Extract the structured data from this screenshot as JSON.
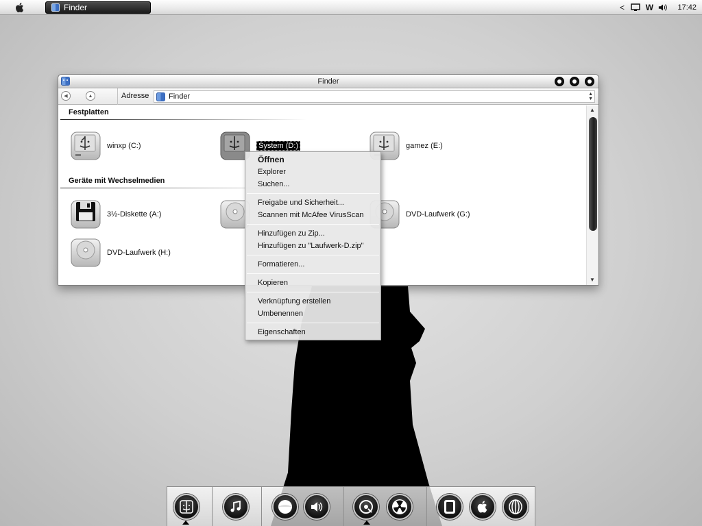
{
  "menubar": {
    "taskbar_item": "Finder",
    "tray": {
      "back_arrow": "<",
      "wordmark": "W",
      "clock": "17:42"
    }
  },
  "window": {
    "title": "Finder",
    "address_label": "Adresse",
    "address_value": "Finder",
    "sections": [
      {
        "title": "Festplatten",
        "drives": [
          {
            "label": "winxp (C:)",
            "icon": "hard-drive-icon"
          },
          {
            "label": "System (D:)",
            "icon": "hard-drive-icon",
            "selected": true
          },
          {
            "label": "gamez (E:)",
            "icon": "hard-drive-icon"
          }
        ]
      },
      {
        "title": "Geräte mit Wechselmedien",
        "drives": [
          {
            "label": "3½-Diskette (A:)",
            "icon": "floppy-drive-icon"
          },
          {
            "label": "",
            "icon": "optical-drive-icon"
          },
          {
            "label": "DVD-Laufwerk (G:)",
            "icon": "optical-drive-icon"
          },
          {
            "label": "DVD-Laufwerk (H:)",
            "icon": "optical-drive-icon"
          }
        ]
      }
    ]
  },
  "context_menu": {
    "groups": [
      [
        "Öffnen",
        "Explorer",
        "Suchen..."
      ],
      [
        "Freigabe und Sicherheit...",
        "Scannen mit McAfee VirusScan"
      ],
      [
        "Hinzufügen zu Zip...",
        "Hinzufügen zu \"Laufwerk-D.zip\""
      ],
      [
        "Formatieren..."
      ],
      [
        "Kopieren"
      ],
      [
        "Verknüpfung erstellen",
        "Umbenennen"
      ],
      [
        "Eigenschaften"
      ]
    ],
    "default_item": "Öffnen"
  },
  "dock": {
    "items": [
      "finder-icon",
      "itunes-icon",
      "media-player-icon",
      "volume-icon",
      "disc-burner-icon",
      "radiation-icon",
      "notes-icon",
      "apple-icon",
      "orb-icon"
    ],
    "running": [
      "finder-icon",
      "disc-burner-icon"
    ]
  },
  "colors": {
    "menubar": "#e9e9e9",
    "selection": "#000000",
    "window_bg": "#ffffff",
    "desktop": "#d0d0d0"
  }
}
